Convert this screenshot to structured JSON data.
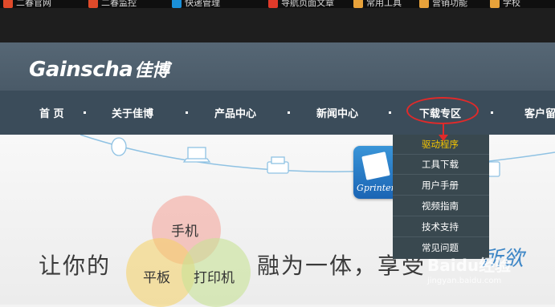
{
  "bookmarks": [
    {
      "label": "二春官网",
      "color": "#e04a2a"
    },
    {
      "label": "二春监控",
      "color": "#e04a2a"
    },
    {
      "label": "快递管理",
      "color": "#1a8fd8"
    },
    {
      "label": "导航页面文章",
      "color": "#e03a2a"
    },
    {
      "label": "常用工具",
      "color": "#e8a23a"
    },
    {
      "label": "营销功能",
      "color": "#e8a23a"
    },
    {
      "label": "学校",
      "color": "#e8a23a"
    }
  ],
  "logo": {
    "brand": "Gainscha",
    "brand_cn": "佳博"
  },
  "nav": {
    "items": [
      "首 页",
      "关于佳博",
      "产品中心",
      "新闻中心",
      "下载专区",
      "客户留"
    ],
    "highlighted": "下载专区",
    "annotation_color": "#e02a2a"
  },
  "dropdown": {
    "items": [
      "驱动程序",
      "工具下载",
      "用户手册",
      "视频指南",
      "技术支持",
      "常见问题"
    ],
    "active_index": 0,
    "active_color": "#f5c500"
  },
  "banner": {
    "app_icon_label": "Gprinter",
    "venn": {
      "top": "手机",
      "left": "平板",
      "right": "打印机"
    },
    "slogan_left": "让你的",
    "slogan_right": "融为一体，享受",
    "script_text": "所欲",
    "watermark": "Baidu经验",
    "watermark_url": "jingyan.baidu.com"
  }
}
